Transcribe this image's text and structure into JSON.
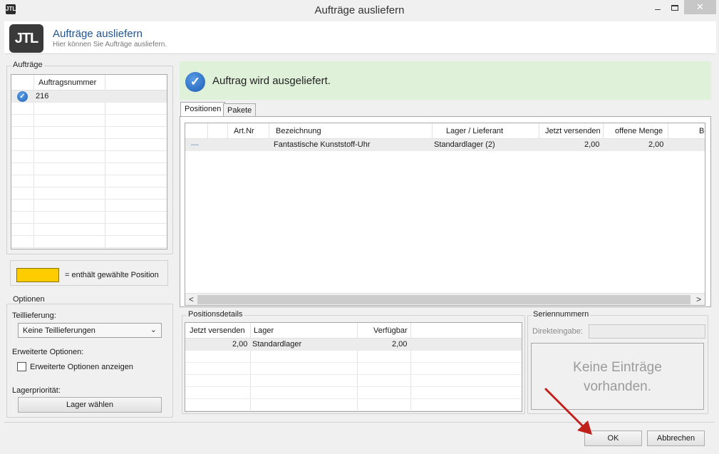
{
  "window": {
    "title": "Aufträge ausliefern",
    "app_icon": "JTL",
    "close_glyph": "✕",
    "minimize_glyph": "–"
  },
  "header": {
    "logo_text": "JTL",
    "title": "Aufträge ausliefern",
    "subtitle": "Hier können Sie Aufträge ausliefern."
  },
  "orders": {
    "group_label": "Aufträge",
    "column": "Auftragsnummer",
    "rows": [
      {
        "number": "216",
        "status_icon": "check-circle-icon"
      }
    ]
  },
  "legend": {
    "text": "=   enthält gewählte Position",
    "color": "#ffcc00"
  },
  "options": {
    "group_label": "Optionen",
    "partial_label": "Teillieferung:",
    "partial_value": "Keine Teillieferungen",
    "advanced_label": "Erweiterte Optionen:",
    "advanced_checkbox": "Erweiterte Optionen anzeigen",
    "priority_label": "Lagerpriorität:",
    "priority_button": "Lager wählen"
  },
  "status": {
    "text": "Auftrag wird ausgeliefert.",
    "color": "#dff1d9"
  },
  "tabs": [
    {
      "label": "Positionen",
      "active": true
    },
    {
      "label": "Pakete",
      "active": false
    }
  ],
  "positions": {
    "columns": [
      "Art.Nr",
      "Bezeichnung",
      "Lager / Lieferant",
      "Jetzt versenden",
      "offene Menge",
      "Be"
    ],
    "rows": [
      {
        "marker": "—",
        "artnr": "",
        "name": "Fantastische Kunststoff-Uhr",
        "warehouse": "Standardlager (2)",
        "ship_now": "2,00",
        "open": "2,00"
      }
    ],
    "scroll_left": "<",
    "scroll_right": ">"
  },
  "details": {
    "group_label": "Positionsdetails",
    "columns": [
      "Jetzt versenden",
      "Lager",
      "Verfügbar"
    ],
    "rows": [
      {
        "ship_now": "2,00",
        "warehouse": "Standardlager",
        "available": "2,00"
      }
    ]
  },
  "serials": {
    "group_label": "Seriennummern",
    "input_label": "Direkteingabe:",
    "empty_line1": "Keine Einträge",
    "empty_line2": "vorhanden."
  },
  "footer": {
    "ok": "OK",
    "cancel": "Abbrechen"
  },
  "annotation": {
    "arrow_color": "#c0201c"
  }
}
